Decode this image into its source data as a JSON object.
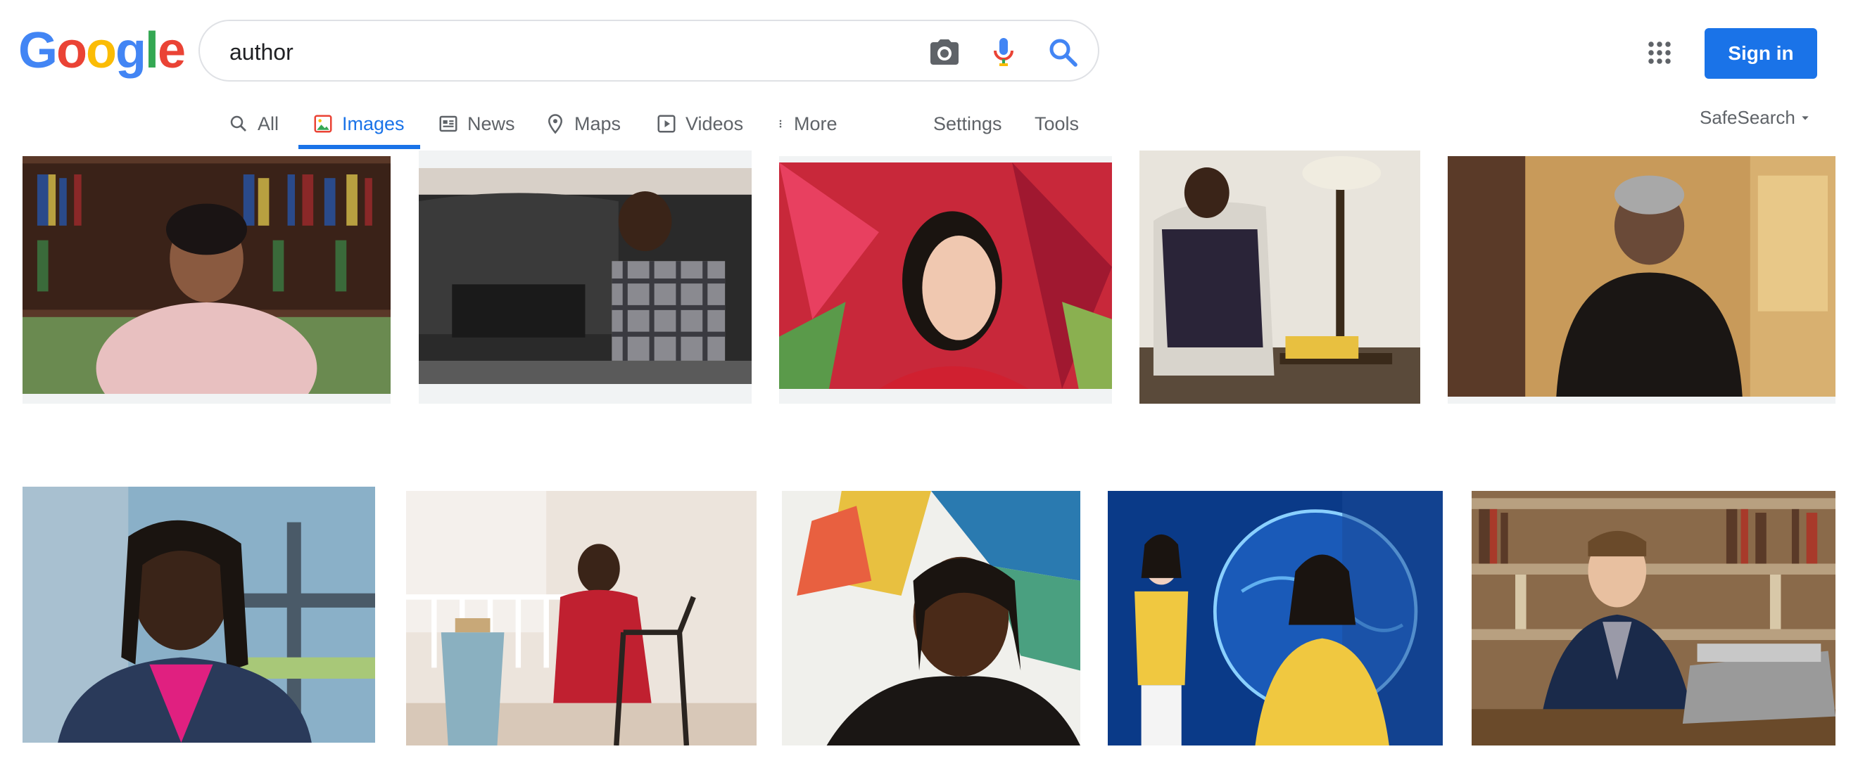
{
  "logo": [
    "G",
    "o",
    "o",
    "g",
    "l",
    "e"
  ],
  "logo_colors": [
    "#4285f4",
    "#ea4335",
    "#fbbc05",
    "#4285f4",
    "#34a853",
    "#ea4335"
  ],
  "search": {
    "value": "author"
  },
  "signin_label": "Sign in",
  "tabs": [
    {
      "label": "All"
    },
    {
      "label": "Images"
    },
    {
      "label": "News"
    },
    {
      "label": "Maps"
    },
    {
      "label": "Videos"
    },
    {
      "label": "More"
    }
  ],
  "tools": {
    "settings": "Settings",
    "tools": "Tools"
  },
  "safesearch": "SafeSearch",
  "colors": {
    "accent": "#1a73e8",
    "muted": "#5f6368",
    "border": "#dfe1e5"
  },
  "icons": [
    "camera-icon",
    "microphone-icon",
    "search-icon",
    "apps-grid-icon",
    "dropdown-arrow-icon"
  ],
  "images": [
    {
      "name": "result-image-woman-pink-shawl-bookshelf",
      "bg": "#6b4a3a",
      "accent": "#e8b7b0"
    },
    {
      "name": "result-image-boy-laptop-couch",
      "bg": "#3a3a3a",
      "accent": "#8a8a8a"
    },
    {
      "name": "result-image-woman-red-background",
      "bg": "#c0303a",
      "accent": "#f0c8b0"
    },
    {
      "name": "result-image-woman-armchair-lamp",
      "bg": "#cfcac2",
      "accent": "#3a3240"
    },
    {
      "name": "result-image-woman-gold-room",
      "bg": "#b58a4a",
      "accent": "#2a2420"
    },
    {
      "name": "result-image-man-dreadlocks-pink-shirt",
      "bg": "#7fa0b8",
      "accent": "#e02080"
    },
    {
      "name": "result-image-woman-red-dress-chair",
      "bg": "#e8e0d8",
      "accent": "#c02030"
    },
    {
      "name": "result-image-man-glasses-colorful-wall",
      "bg": "#e8e0c0",
      "accent": "#1a1a1a"
    },
    {
      "name": "result-image-news-anchors-blue-screen",
      "bg": "#1a5ab0",
      "accent": "#f0c840"
    },
    {
      "name": "result-image-man-typewriter-library",
      "bg": "#8a6a4a",
      "accent": "#1a2a4a"
    }
  ]
}
